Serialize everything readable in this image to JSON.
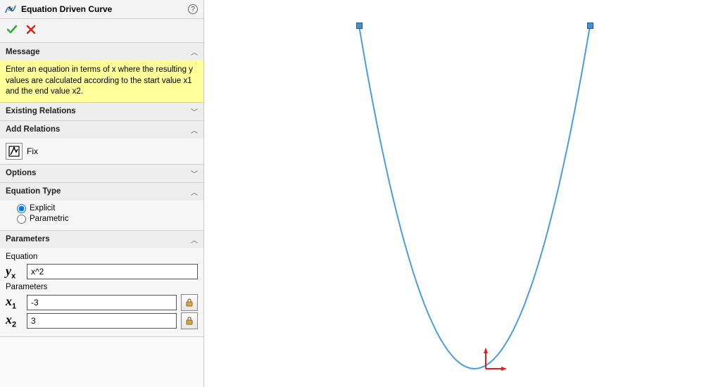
{
  "header": {
    "title": "Equation Driven Curve"
  },
  "sections": {
    "message": {
      "label": "Message",
      "text": "Enter an equation in terms of x where the resulting y values are calculated according to the start value x1 and the end value x2."
    },
    "existing_relations": {
      "label": "Existing Relations"
    },
    "add_relations": {
      "label": "Add Relations",
      "fix_label": "Fix"
    },
    "options": {
      "label": "Options"
    },
    "equation_type": {
      "label": "Equation Type",
      "explicit": "Explicit",
      "parametric": "Parametric",
      "selected": "explicit"
    },
    "parameters": {
      "label": "Parameters",
      "equation_label": "Equation",
      "params_label": "Parameters",
      "yx_value": "x^2",
      "x1_value": "-3",
      "x2_value": "3"
    }
  },
  "chart_data": {
    "type": "line",
    "title": "",
    "xlabel": "",
    "ylabel": "",
    "xlim": [
      -3,
      3
    ],
    "ylim": [
      0,
      9
    ],
    "equation": "y = x^2",
    "series": [
      {
        "name": "x^2",
        "x": [
          -3,
          -2.5,
          -2,
          -1.5,
          -1,
          -0.5,
          0,
          0.5,
          1,
          1.5,
          2,
          2.5,
          3
        ],
        "y": [
          9,
          6.25,
          4,
          2.25,
          1,
          0.25,
          0,
          0.25,
          1,
          2.25,
          4,
          6.25,
          9
        ]
      }
    ]
  }
}
